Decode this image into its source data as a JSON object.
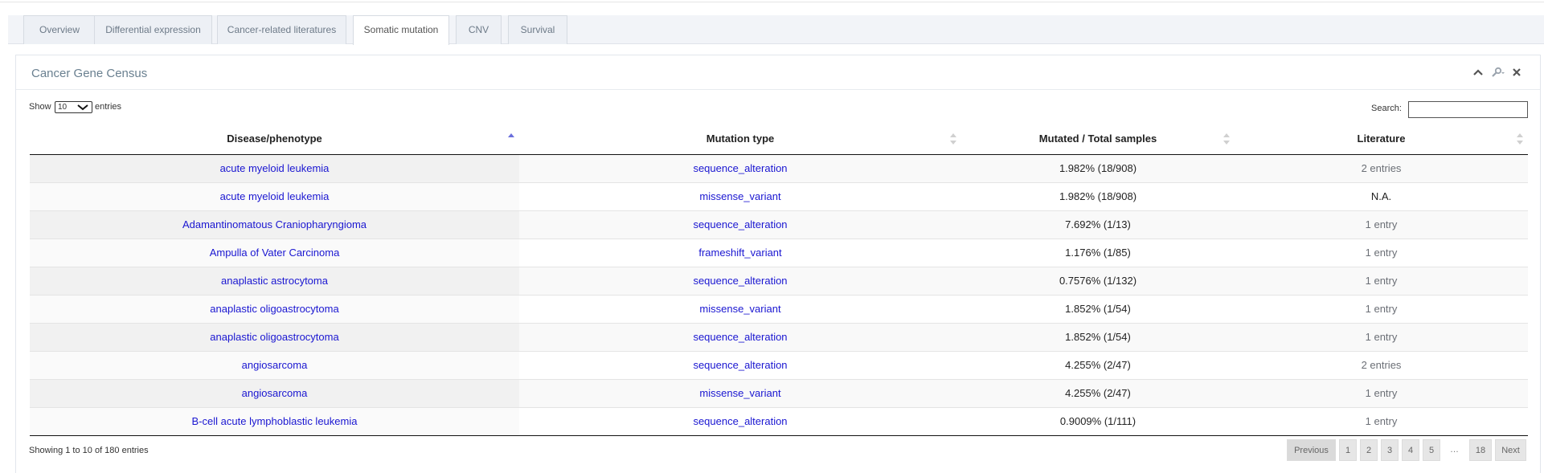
{
  "tabs": [
    {
      "label": "Overview"
    },
    {
      "label": "Differential expression"
    },
    {
      "label": "Cancer-related literatures"
    },
    {
      "label": "Somatic mutation",
      "active": true
    },
    {
      "label": "CNV"
    },
    {
      "label": "Survival"
    }
  ],
  "panel": {
    "title": "Cancer Gene Census",
    "tools": [
      "chevron-up-icon",
      "wrench-icon",
      "close-icon"
    ]
  },
  "length": {
    "prefix": "Show",
    "value": "10",
    "suffix": "entries"
  },
  "search": {
    "label": "Search:",
    "value": ""
  },
  "table": {
    "columns": [
      "Disease/phenotype",
      "Mutation type",
      "Mutated / Total samples",
      "Literature"
    ],
    "sort": {
      "column": "Disease/phenotype",
      "direction": "ascending"
    },
    "rows": [
      {
        "disease": "acute myeloid leukemia",
        "mutation": "sequence_alteration",
        "samples": "1.982% (18/908)",
        "literature": "2 entries",
        "lit_link": true
      },
      {
        "disease": "acute myeloid leukemia",
        "mutation": "missense_variant",
        "samples": "1.982% (18/908)",
        "literature": "N.A.",
        "lit_link": false
      },
      {
        "disease": "Adamantinomatous Craniopharyngioma",
        "mutation": "sequence_alteration",
        "samples": "7.692% (1/13)",
        "literature": "1 entry",
        "lit_link": true
      },
      {
        "disease": "Ampulla of Vater Carcinoma",
        "mutation": "frameshift_variant",
        "samples": "1.176% (1/85)",
        "literature": "1 entry",
        "lit_link": true
      },
      {
        "disease": "anaplastic astrocytoma",
        "mutation": "sequence_alteration",
        "samples": "0.7576% (1/132)",
        "literature": "1 entry",
        "lit_link": true
      },
      {
        "disease": "anaplastic oligoastrocytoma",
        "mutation": "missense_variant",
        "samples": "1.852% (1/54)",
        "literature": "1 entry",
        "lit_link": true
      },
      {
        "disease": "anaplastic oligoastrocytoma",
        "mutation": "sequence_alteration",
        "samples": "1.852% (1/54)",
        "literature": "1 entry",
        "lit_link": true
      },
      {
        "disease": "angiosarcoma",
        "mutation": "sequence_alteration",
        "samples": "4.255% (2/47)",
        "literature": "2 entries",
        "lit_link": true
      },
      {
        "disease": "angiosarcoma",
        "mutation": "missense_variant",
        "samples": "4.255% (2/47)",
        "literature": "1 entry",
        "lit_link": true
      },
      {
        "disease": "B-cell acute lymphoblastic leukemia",
        "mutation": "sequence_alteration",
        "samples": "0.9009% (1/111)",
        "literature": "1 entry",
        "lit_link": true
      }
    ]
  },
  "info": "Showing 1 to 10 of 180 entries",
  "pagination": {
    "previous": "Previous",
    "pages": [
      "1",
      "2",
      "3",
      "4",
      "5"
    ],
    "ellipsis": "…",
    "last": "18",
    "next": "Next"
  },
  "colors": {
    "link": "#1a16d1",
    "literature_link": "#6b6f76",
    "title": "#6a8090"
  }
}
